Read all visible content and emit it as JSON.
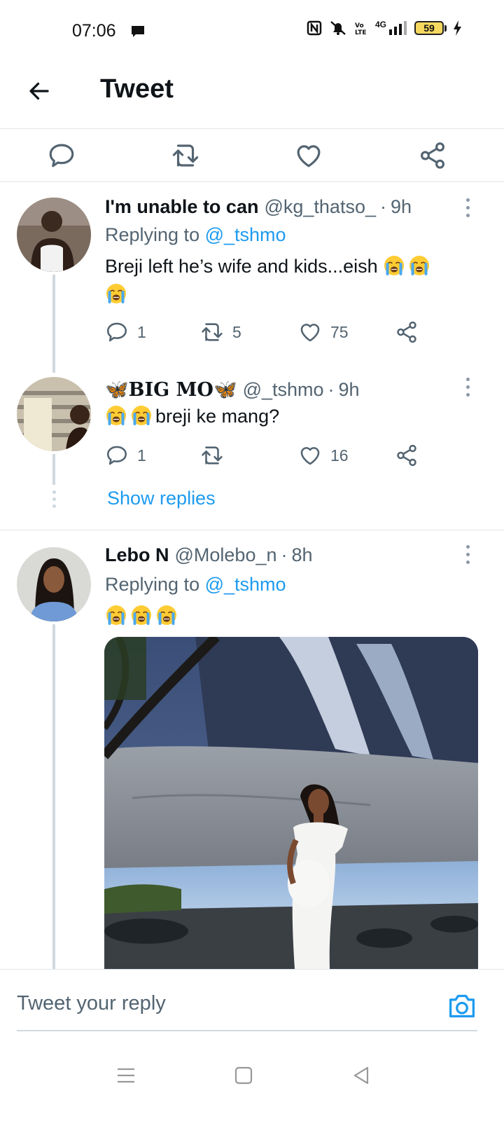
{
  "status_bar": {
    "time": "07:06",
    "battery": "59",
    "network": "4G"
  },
  "header": {
    "title": "Tweet"
  },
  "replies": [
    {
      "name": "I'm unable to can",
      "handle": "@kg_thatso_",
      "time": "9h",
      "replying_prefix": "Replying to",
      "replying_to": "@_tshmo",
      "text": "Breji left he’s wife and kids...eish",
      "emoji_count_inline": 2,
      "emoji_count_line2": 1,
      "replies": "1",
      "retweets": "5",
      "likes": "75"
    },
    {
      "name_prefix": "🦋",
      "name": "BIG MO",
      "name_suffix": "🦋",
      "handle": "@_tshmo",
      "time": "9h",
      "text": "breji ke mang?",
      "emoji_count_inline": 2,
      "replies": "1",
      "retweets": "",
      "likes": "16",
      "show_replies": "Show replies"
    },
    {
      "name": "Lebo N",
      "handle": "@Molebo_n",
      "time": "8h",
      "replying_prefix": "Replying to",
      "replying_to": "@_tshmo",
      "emoji_count_inline": 3
    }
  ],
  "reply_bar": {
    "placeholder": "Tweet your reply"
  },
  "colors": {
    "accent": "#1d9bf0",
    "secondary_text": "#536471",
    "primary_text": "#0f1419"
  },
  "icons": {
    "back": "arrow-left-icon",
    "reply": "speech-bubble-icon",
    "retweet": "retweet-icon",
    "like": "heart-icon",
    "share": "share-icon",
    "more": "vertical-dots-icon",
    "camera": "camera-icon",
    "emoji": "loudly-crying-face-emoji"
  }
}
